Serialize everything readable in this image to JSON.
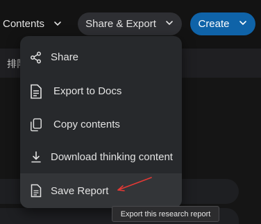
{
  "toolbar": {
    "contents_label": "Contents",
    "share_export_label": "Share & Export",
    "create_label": "Create"
  },
  "background": {
    "row_text": "排队"
  },
  "menu": {
    "items": [
      {
        "label": "Share",
        "icon": "share-icon"
      },
      {
        "label": "Export to Docs",
        "icon": "document-icon"
      },
      {
        "label": "Copy contents",
        "icon": "copy-icon"
      },
      {
        "label": "Download thinking content",
        "icon": "download-icon"
      },
      {
        "label": "Save Report",
        "icon": "save-document-icon"
      }
    ]
  },
  "tooltip": {
    "text": "Export this research report"
  },
  "annotation": {
    "arrow_color": "#e53935"
  },
  "colors": {
    "accent": "#0f63a8",
    "menu_bg": "#27292c",
    "hover_bg": "#333538"
  }
}
